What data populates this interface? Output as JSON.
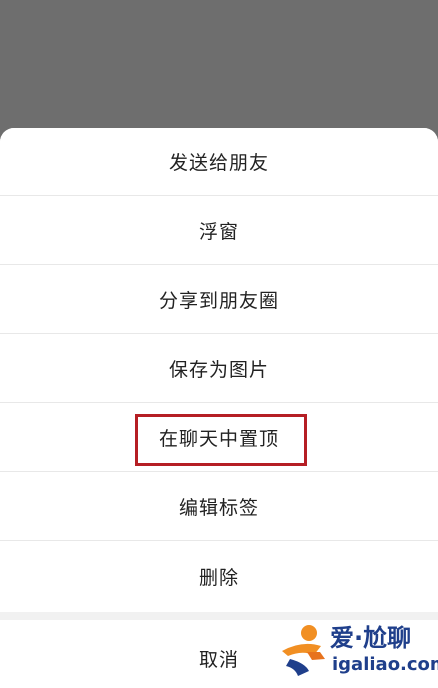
{
  "menu": {
    "items": [
      {
        "label": "发送给朋友"
      },
      {
        "label": "浮窗"
      },
      {
        "label": "分享到朋友圈"
      },
      {
        "label": "保存为图片"
      },
      {
        "label": "在聊天中置顶"
      },
      {
        "label": "编辑标签"
      },
      {
        "label": "删除"
      }
    ],
    "cancel_label": "取消"
  },
  "watermark": {
    "brand": "爱·尬聊",
    "url": "igaliao.com"
  },
  "colors": {
    "overlay": "#6e6e6e",
    "highlight_border": "#b51e24",
    "text": "#222222",
    "watermark": "#1f3f8b"
  },
  "icons": {
    "watermark_logo": "runner-icon"
  }
}
